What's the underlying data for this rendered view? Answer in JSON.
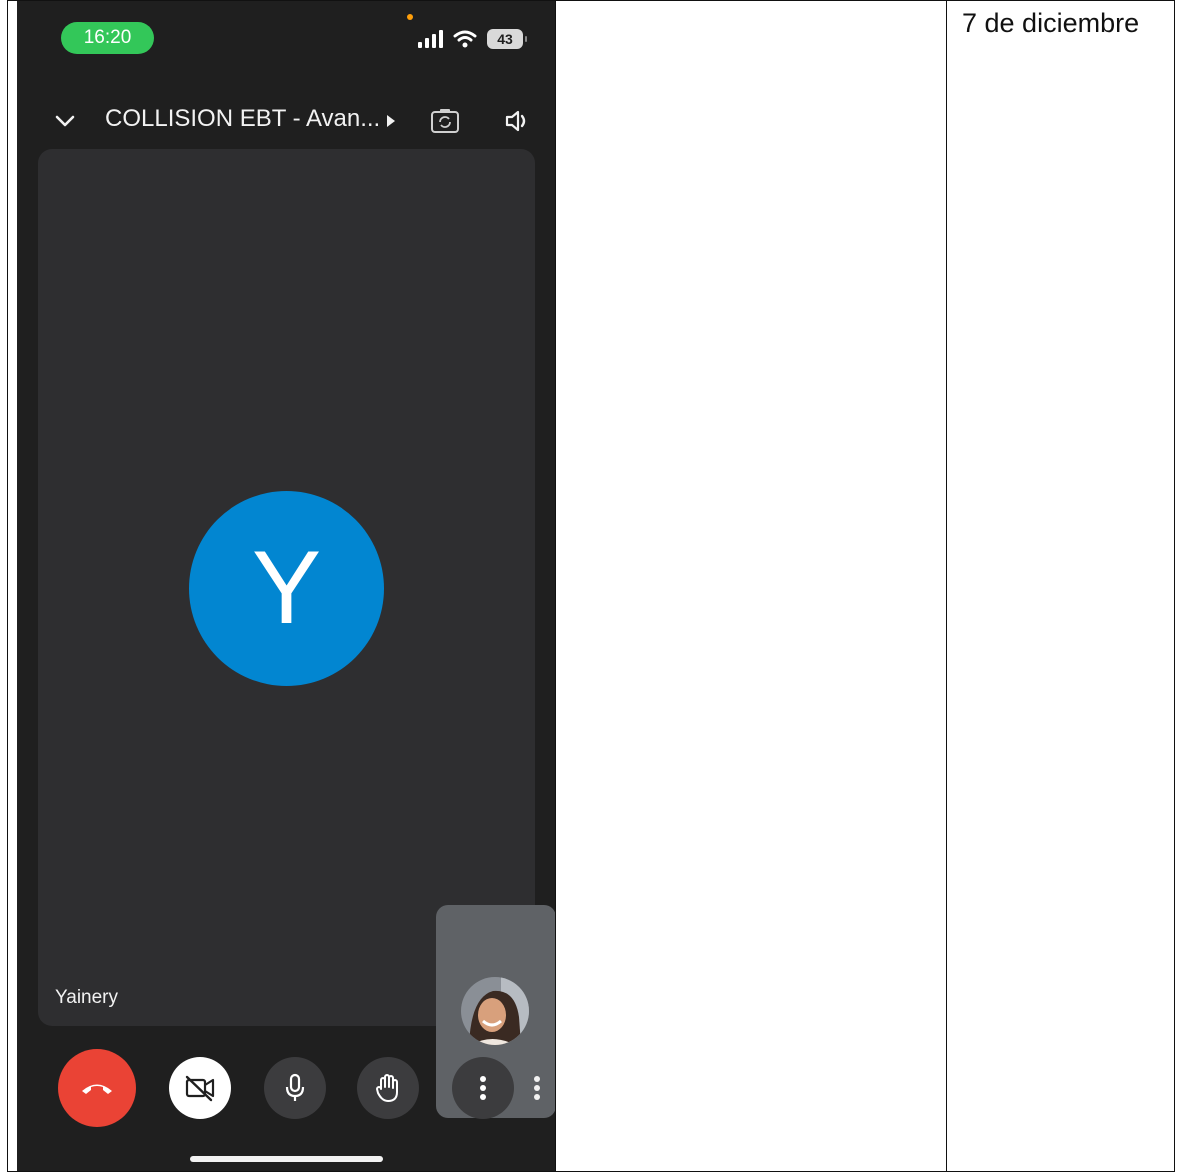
{
  "status_bar": {
    "time": "16:20",
    "battery": "43"
  },
  "meeting": {
    "title": "COLLISION EBT - Avan...",
    "participant_initial": "Y",
    "participant_name": "Yainery"
  },
  "date_note": "7 de diciembre",
  "icons": {
    "collapse": "chevron-down-icon",
    "camera_switch": "camera-switch-icon",
    "speaker": "speaker-icon",
    "end_call": "end-call-icon",
    "video_off": "video-off-icon",
    "mic": "microphone-icon",
    "raise_hand": "raise-hand-icon",
    "more": "more-options-icon"
  },
  "colors": {
    "end_call": "#ea4335",
    "avatar": "#0286d1",
    "time_pill": "#33c759"
  }
}
